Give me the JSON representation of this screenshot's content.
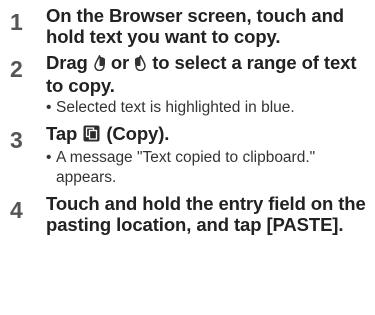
{
  "steps": [
    {
      "number": "1",
      "text": "On the Browser screen, touch and hold text you want to copy."
    },
    {
      "number": "2",
      "text_before": "Drag",
      "text_mid": "or",
      "text_after": "to select a range of text to copy.",
      "icon_left": "selection-handle-left-icon",
      "icon_right": "selection-handle-right-icon",
      "note": "Selected text is highlighted in blue."
    },
    {
      "number": "3",
      "text_before": "Tap",
      "text_after": "(Copy).",
      "icon": "copy-icon",
      "note": "A message \"Text copied to clipboard.\" appears."
    },
    {
      "number": "4",
      "text": "Touch and hold the entry field on the pasting location, and tap [PASTE]."
    }
  ],
  "note_bullet": "•"
}
